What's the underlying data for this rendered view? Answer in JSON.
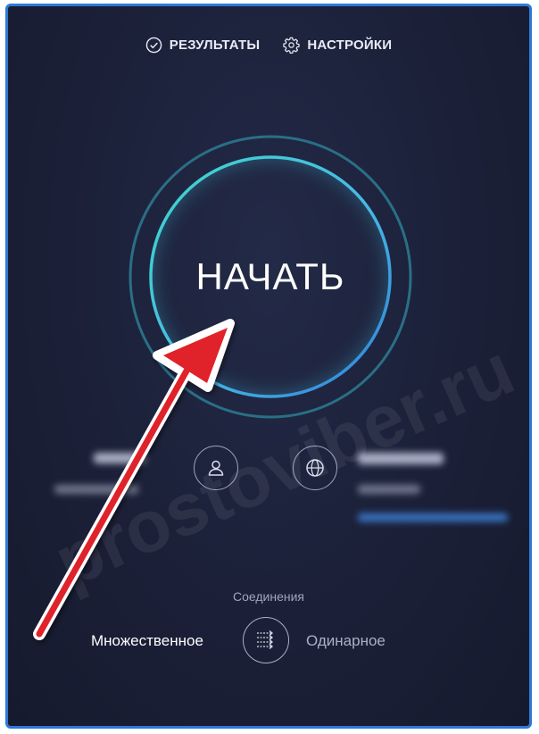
{
  "nav": {
    "results_label": "РЕЗУЛЬТАТЫ",
    "settings_label": "НАСТРОЙКИ",
    "results_icon": "check-circle-icon",
    "settings_icon": "gear-icon"
  },
  "start": {
    "label": "НАЧАТЬ"
  },
  "connections": {
    "title": "Соединения",
    "multi_label": "Множественное",
    "single_label": "Одинарное",
    "toggle_icon": "multi-arrows-icon"
  },
  "watermark": {
    "text": "prostoviber.ru"
  },
  "colors": {
    "background": "#1b2038",
    "frame_border": "#2f79d6",
    "ring_outer": "#2a6f86",
    "ring_inner": "#48d2d8",
    "arrow": "#e0232b"
  }
}
